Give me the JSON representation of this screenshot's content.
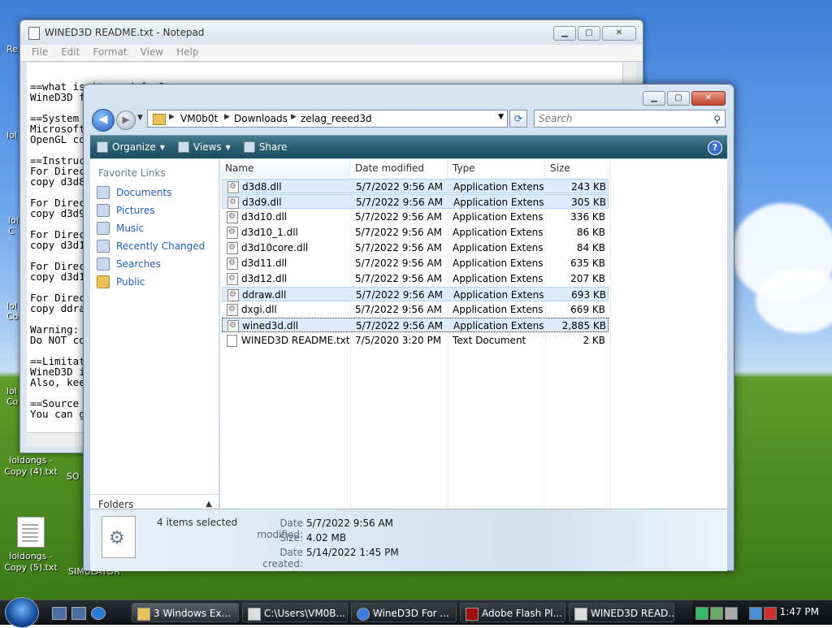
{
  "desktop": {
    "icons": [
      {
        "label": "loldongs - Copy (4).txt"
      },
      {
        "label": "loldongs - Copy (5).txt"
      }
    ],
    "partial_labels": [
      "Re",
      "lol",
      "lol\nC",
      "lol\nCo",
      "lol\nCo",
      "SO",
      "B\nSIMULATOR"
    ]
  },
  "notepad": {
    "title": "WINED3D README.txt - Notepad",
    "menu": [
      "File",
      "Edit",
      "Format",
      "View",
      "Help"
    ],
    "text": "\n==what is it good for?==\nWineD3D f\n\n==System\nMicrosoft\nOpenGL co\n\n==Instruc\nFor Direc\ncopy d3d8\n\nFor Direc\ncopy d3d9\n\nFor Direc\ncopy d3d1\n\nFor Direc\ncopy d3d1\n\nFor Direc\ncopy ddra\n\nWarning: \nDo NOT co\n\n==Limitat\nWineD3D i\nAlso, kee\n\n==Source \nYou can g"
  },
  "explorer": {
    "breadcrumb": [
      "VM0b0t",
      "Downloads",
      "zelag_reeed3d"
    ],
    "search_placeholder": "Search",
    "toolbar": {
      "organize": "Organize",
      "views": "Views",
      "share": "Share",
      "help": "?"
    },
    "favorites_title": "Favorite Links",
    "favorites": [
      {
        "label": "Documents",
        "icon": "documents-icon"
      },
      {
        "label": "Pictures",
        "icon": "pictures-icon"
      },
      {
        "label": "Music",
        "icon": "music-icon"
      },
      {
        "label": "Recently Changed",
        "icon": "recent-icon"
      },
      {
        "label": "Searches",
        "icon": "searches-icon"
      },
      {
        "label": "Public",
        "icon": "folder-icon"
      }
    ],
    "folders_label": "Folders",
    "columns": [
      "Name",
      "Date modified",
      "Type",
      "Size"
    ],
    "files": [
      {
        "name": "d3d8.dll",
        "date": "5/7/2022 9:56 AM",
        "type": "Application Extens...",
        "size": "243 KB",
        "state": "selected"
      },
      {
        "name": "d3d9.dll",
        "date": "5/7/2022 9:56 AM",
        "type": "Application Extens...",
        "size": "305 KB",
        "state": "selected"
      },
      {
        "name": "d3d10.dll",
        "date": "5/7/2022 9:56 AM",
        "type": "Application Extens...",
        "size": "336 KB",
        "state": ""
      },
      {
        "name": "d3d10_1.dll",
        "date": "5/7/2022 9:56 AM",
        "type": "Application Extens...",
        "size": "86 KB",
        "state": ""
      },
      {
        "name": "d3d10core.dll",
        "date": "5/7/2022 9:56 AM",
        "type": "Application Extens...",
        "size": "84 KB",
        "state": ""
      },
      {
        "name": "d3d11.dll",
        "date": "5/7/2022 9:56 AM",
        "type": "Application Extens...",
        "size": "635 KB",
        "state": ""
      },
      {
        "name": "d3d12.dll",
        "date": "5/7/2022 9:56 AM",
        "type": "Application Extens...",
        "size": "207 KB",
        "state": ""
      },
      {
        "name": "ddraw.dll",
        "date": "5/7/2022 9:56 AM",
        "type": "Application Extens...",
        "size": "693 KB",
        "state": "selected"
      },
      {
        "name": "dxgi.dll",
        "date": "5/7/2022 9:56 AM",
        "type": "Application Extens...",
        "size": "669 KB",
        "state": ""
      },
      {
        "name": "wined3d.dll",
        "date": "5/7/2022 9:56 AM",
        "type": "Application Extens...",
        "size": "2,885 KB",
        "state": "focused"
      },
      {
        "name": "WINED3D README.txt",
        "date": "7/5/2020 3:20 PM",
        "type": "Text Document",
        "size": "2 KB",
        "state": "",
        "kind": "txt"
      }
    ],
    "details": {
      "count": "4 items selected",
      "date_modified_label": "Date modified:",
      "date_modified": "5/7/2022 9:56 AM",
      "size_label": "Size:",
      "size": "4.02 MB",
      "date_created_label": "Date created:",
      "date_created": "5/14/2022 1:45 PM"
    }
  },
  "taskbar": {
    "buttons": [
      {
        "label": "3 Windows Ex...",
        "active": true
      },
      {
        "label": "C:\\Users\\VM0B...",
        "active": false
      },
      {
        "label": "WineD3D For ...",
        "active": false
      },
      {
        "label": "Adobe Flash Pl...",
        "active": false
      },
      {
        "label": "WINED3D READ...",
        "active": false
      }
    ],
    "clock": "1:47 PM"
  }
}
